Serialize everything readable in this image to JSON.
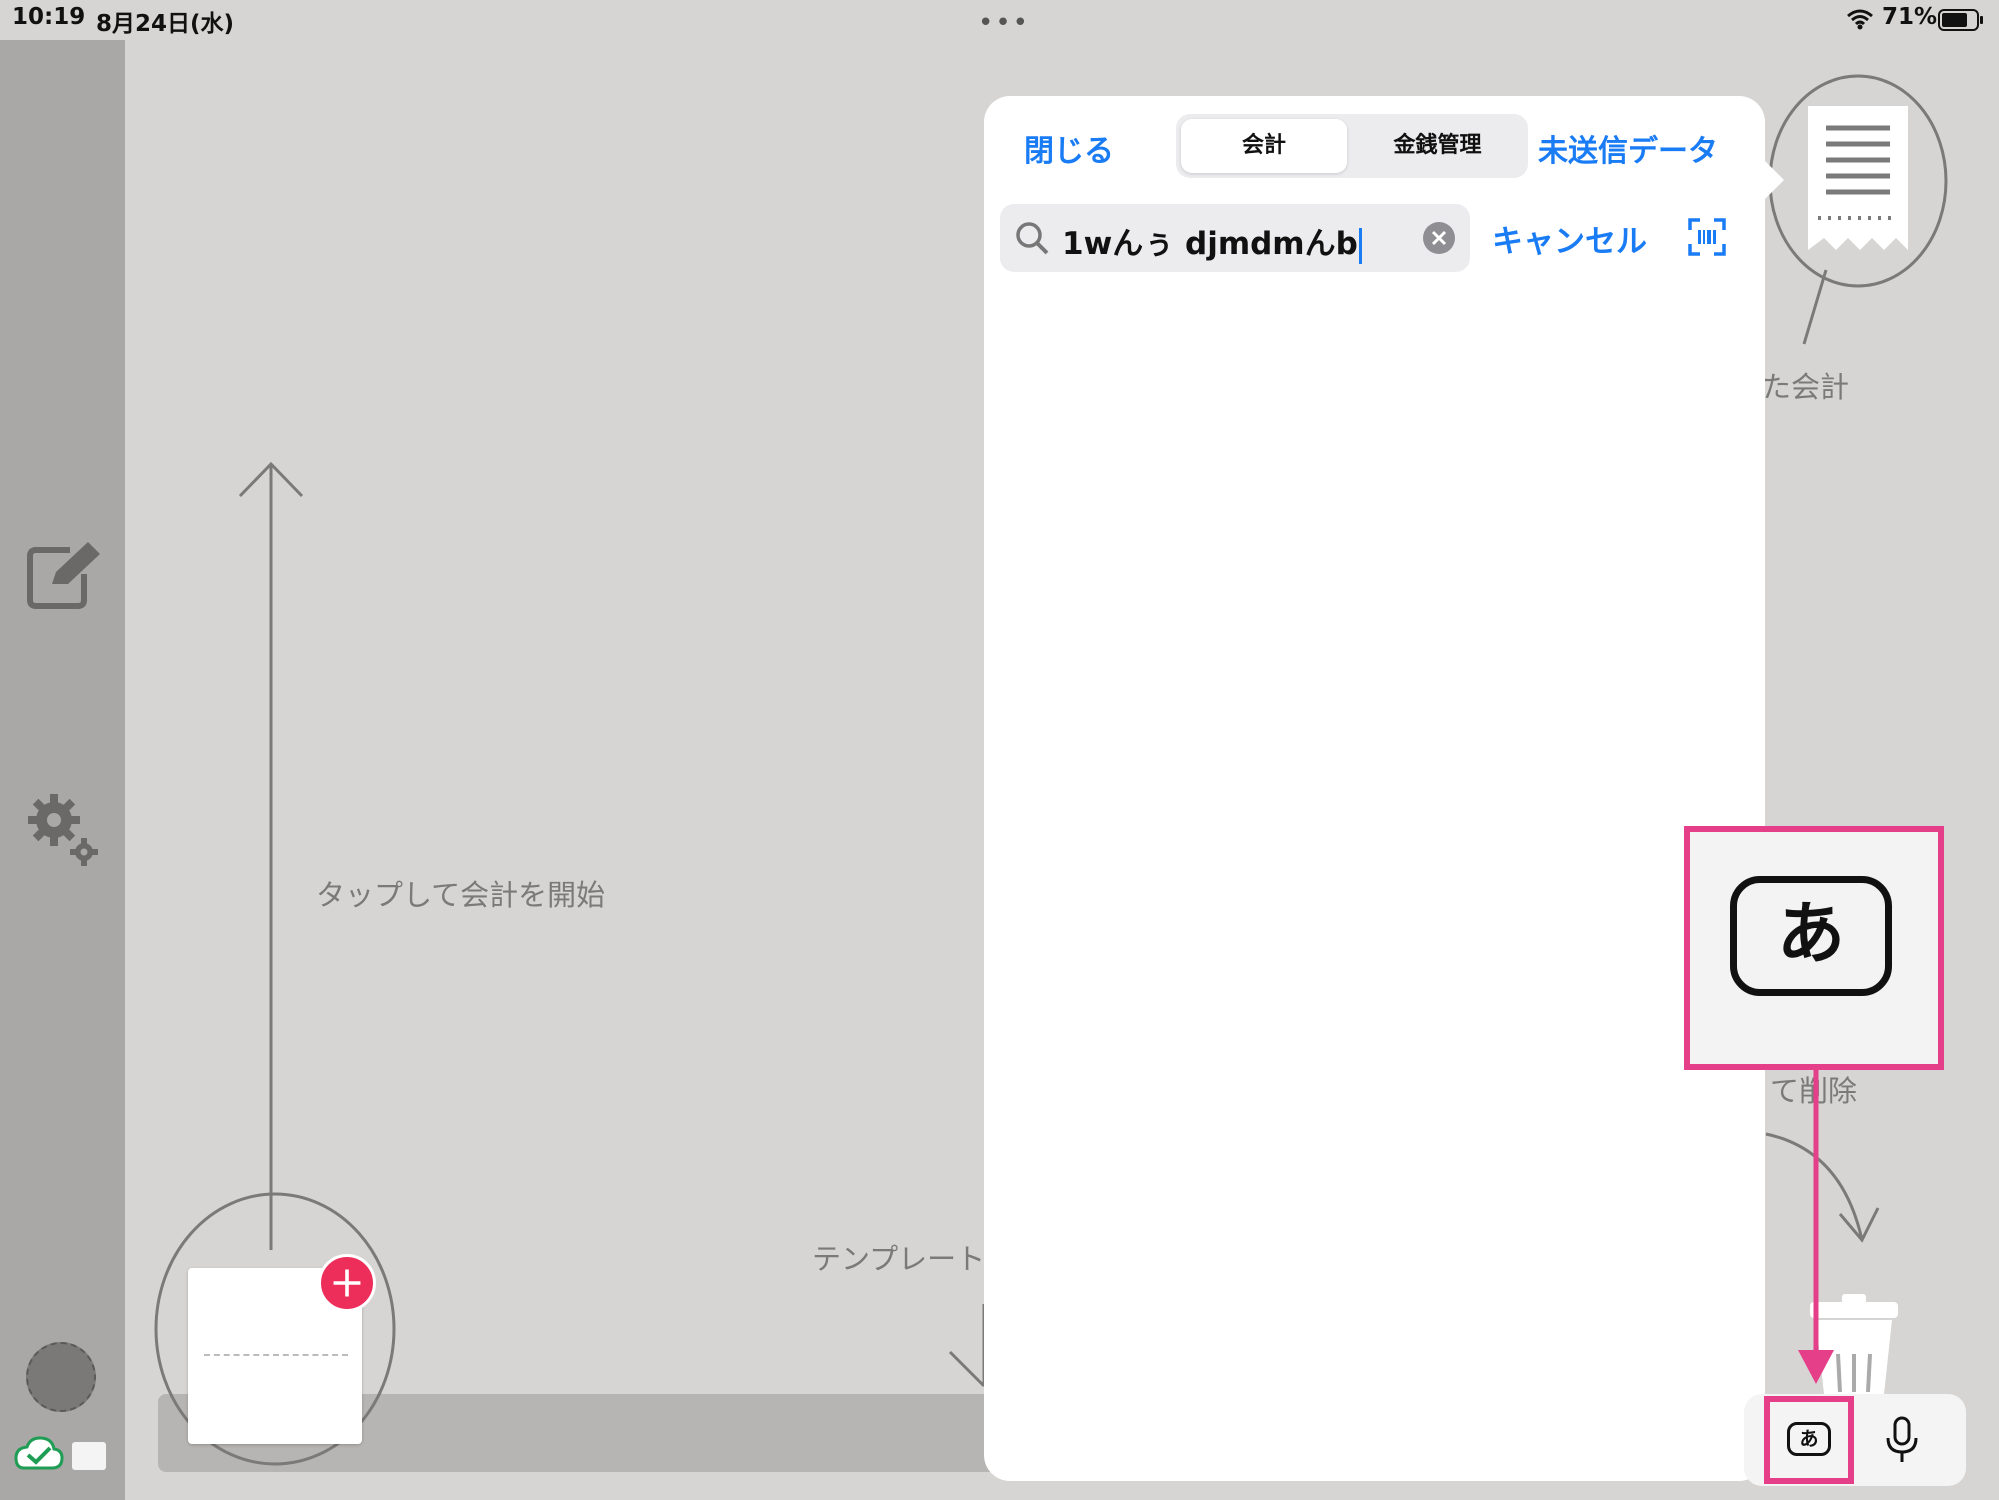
{
  "status_bar": {
    "time": "10:19",
    "date": "8月24日(水)",
    "battery_percent": "71%",
    "battery_level": 0.71
  },
  "guide": {
    "tap_to_start": "タップして会計を開始",
    "template_label": "テンプレート",
    "right_label_top": "た会計",
    "right_label_bottom": "て削除"
  },
  "popover": {
    "close_label": "閉じる",
    "segments": [
      {
        "label": "会計",
        "selected": true
      },
      {
        "label": "金銭管理",
        "selected": false
      }
    ],
    "unsent_label": "未送信データ",
    "search": {
      "value": "1wんぅ djmdmんb"
    },
    "cancel_label": "キャンセル"
  },
  "keyboard_bar": {
    "kana_key": "あ",
    "zoomed_kana_key": "あ"
  },
  "colors": {
    "accent": "#1a7cf5",
    "highlight": "#e63f8a",
    "badge": "#ee2e5a",
    "background": "#d6d5d3",
    "sidebar": "#a9a8a6"
  },
  "icons": [
    "wifi-icon",
    "battery-icon",
    "compose-icon",
    "settings-icon",
    "cloud-check-icon",
    "plus-icon",
    "receipt-icon",
    "trash-icon",
    "search-icon",
    "clear-icon",
    "barcode-scan-icon",
    "microphone-icon"
  ]
}
